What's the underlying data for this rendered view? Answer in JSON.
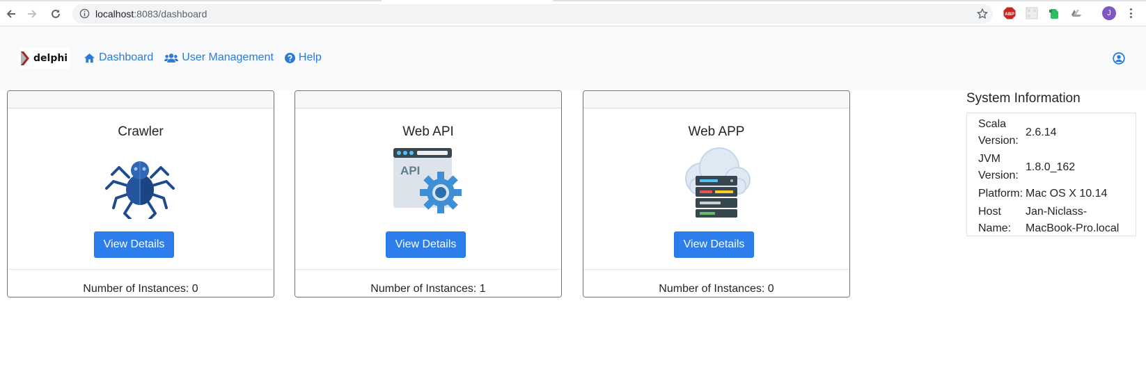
{
  "browser": {
    "url_host": "localhost",
    "url_rest": ":8083/dashboard",
    "profile_initial": "J",
    "extensions": [
      "adblock-icon",
      "qr-icon",
      "evernote-icon",
      "drive-icon"
    ],
    "extension_labels": {
      "adblock": "ABP"
    }
  },
  "navbar": {
    "brand": "delphi",
    "links": [
      {
        "label": "Dashboard",
        "icon": "home-icon"
      },
      {
        "label": "User Management",
        "icon": "users-icon"
      },
      {
        "label": "Help",
        "icon": "question-circle-icon"
      }
    ],
    "user_icon": "user-circle-icon",
    "link_color": "#2b7bd6"
  },
  "cards": [
    {
      "title": "Crawler",
      "icon": "spider-icon",
      "button": "View Details",
      "footer": "Number of Instances: 0"
    },
    {
      "title": "Web API",
      "icon": "api-gear-icon",
      "button": "View Details",
      "footer": "Number of Instances: 1"
    },
    {
      "title": "Web APP",
      "icon": "cloud-server-icon",
      "button": "View Details",
      "footer": "Number of Instances: 0"
    }
  ],
  "system_info": {
    "title": "System Information",
    "rows": [
      {
        "key": "Scala Version:",
        "value": "2.6.14"
      },
      {
        "key": "JVM Version:",
        "value": "1.8.0_162"
      },
      {
        "key": "Platform:",
        "value": "Mac OS X 10.14"
      },
      {
        "key": "Host Name:",
        "value": "Jan-Niclass-MacBook-Pro.local"
      }
    ]
  },
  "colors": {
    "primary_button": "#2d7eea",
    "navbar_bg": "#f8f9fa"
  }
}
